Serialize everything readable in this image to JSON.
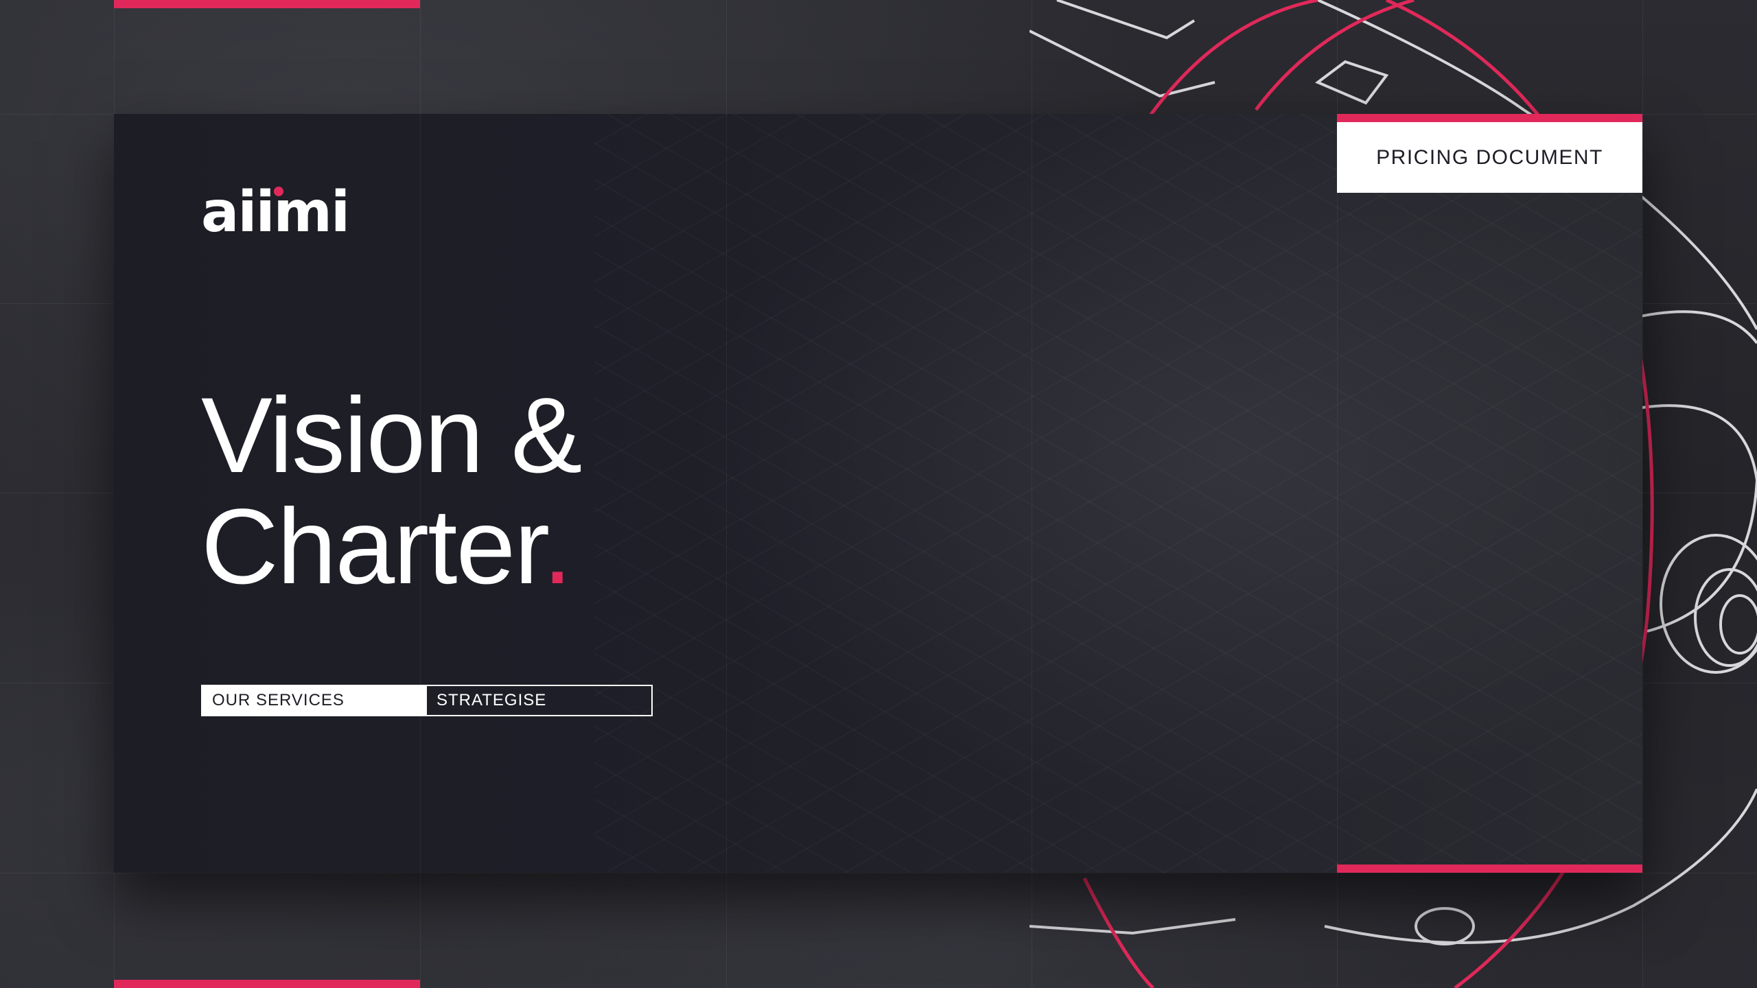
{
  "brand": {
    "logo_text": "aiimi",
    "accent_color": "#e0295a"
  },
  "hero": {
    "title_line1": "Vision &",
    "title_line2": "Charter",
    "title_period": "."
  },
  "tags": [
    {
      "label": "OUR SERVICES"
    },
    {
      "label": "STRATEGISE"
    }
  ],
  "document_label": "PRICING DOCUMENT"
}
